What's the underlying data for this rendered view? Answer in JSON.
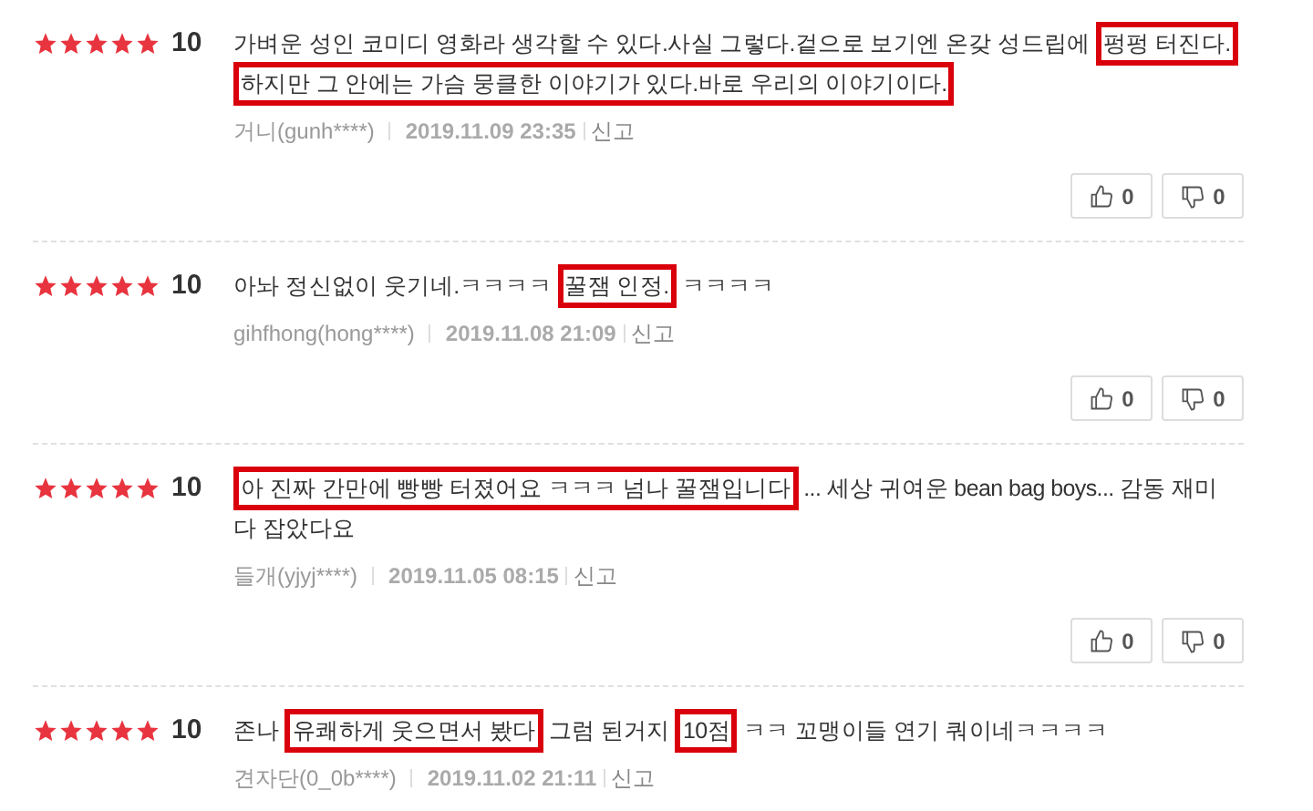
{
  "reviews": [
    {
      "stars": 5,
      "score": "10",
      "lines": [
        [
          {
            "text": "가벼운 성인 코미디 영화라 생각할 수 있다.사실 그렇다.겉으로 보기엔 온갖 성드립에",
            "highlighted": false
          },
          {
            "text": "펑펑 터진다.",
            "highlighted": true
          }
        ],
        [
          {
            "text": "하지만 그 안에는 가슴 뭉클한 이야기가 있다.바로 우리의 이야기이다.",
            "highlighted": true
          }
        ]
      ],
      "author": "거니(gunh****)",
      "date": "2019.11.09 23:35",
      "report": "신고",
      "likes": "0",
      "dislikes": "0"
    },
    {
      "stars": 5,
      "score": "10",
      "lines": [
        [
          {
            "text": "아놔 정신없이 웃기네.ㅋㅋㅋㅋ",
            "highlighted": false
          },
          {
            "text": "꿀잼 인정.",
            "highlighted": true
          },
          {
            "text": "ㅋㅋㅋㅋ",
            "highlighted": false
          }
        ]
      ],
      "author": "gihfhong(hong****)",
      "date": "2019.11.08 21:09",
      "report": "신고",
      "likes": "0",
      "dislikes": "0"
    },
    {
      "stars": 5,
      "score": "10",
      "lines": [
        [
          {
            "text": "아 진짜 간만에 빵빵 터졌어요 ㅋㅋㅋ 넘나 꿀잼입니다",
            "highlighted": true
          },
          {
            "text": "... 세상 귀여운 bean bag boys... 감동 재미",
            "highlighted": false
          }
        ],
        [
          {
            "text": "다 잡았다요",
            "highlighted": false
          }
        ]
      ],
      "author": "들개(yjyj****)",
      "date": "2019.11.05 08:15",
      "report": "신고",
      "likes": "0",
      "dislikes": "0"
    },
    {
      "stars": 5,
      "score": "10",
      "lines": [
        [
          {
            "text": "존나",
            "highlighted": false
          },
          {
            "text": "유쾌하게 웃으면서 봤다",
            "highlighted": true
          },
          {
            "text": "그럼 된거지",
            "highlighted": false
          },
          {
            "text": "10점",
            "highlighted": true
          },
          {
            "text": "ㅋㅋ 꼬맹이들 연기 쿼이네ㅋㅋㅋㅋ",
            "highlighted": false
          }
        ]
      ],
      "author": "견자단(0_0b****)",
      "date": "2019.11.02 21:11",
      "report": "신고"
    }
  ]
}
